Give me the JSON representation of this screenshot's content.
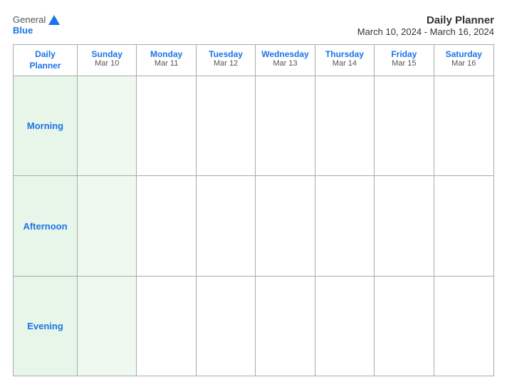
{
  "logo": {
    "general": "General",
    "blue": "Blue"
  },
  "header": {
    "title": "Daily Planner",
    "date_range": "March 10, 2024 - March 16, 2024"
  },
  "columns": [
    {
      "label": "Daily\nPlanner",
      "is_label": true
    },
    {
      "day": "Sunday",
      "date": "Mar 10"
    },
    {
      "day": "Monday",
      "date": "Mar 11"
    },
    {
      "day": "Tuesday",
      "date": "Mar 12"
    },
    {
      "day": "Wednesday",
      "date": "Mar 13"
    },
    {
      "day": "Thursday",
      "date": "Mar 14"
    },
    {
      "day": "Friday",
      "date": "Mar 15"
    },
    {
      "day": "Saturday",
      "date": "Mar 16"
    }
  ],
  "rows": [
    {
      "label": "Morning"
    },
    {
      "label": "Afternoon"
    },
    {
      "label": "Evening"
    }
  ]
}
